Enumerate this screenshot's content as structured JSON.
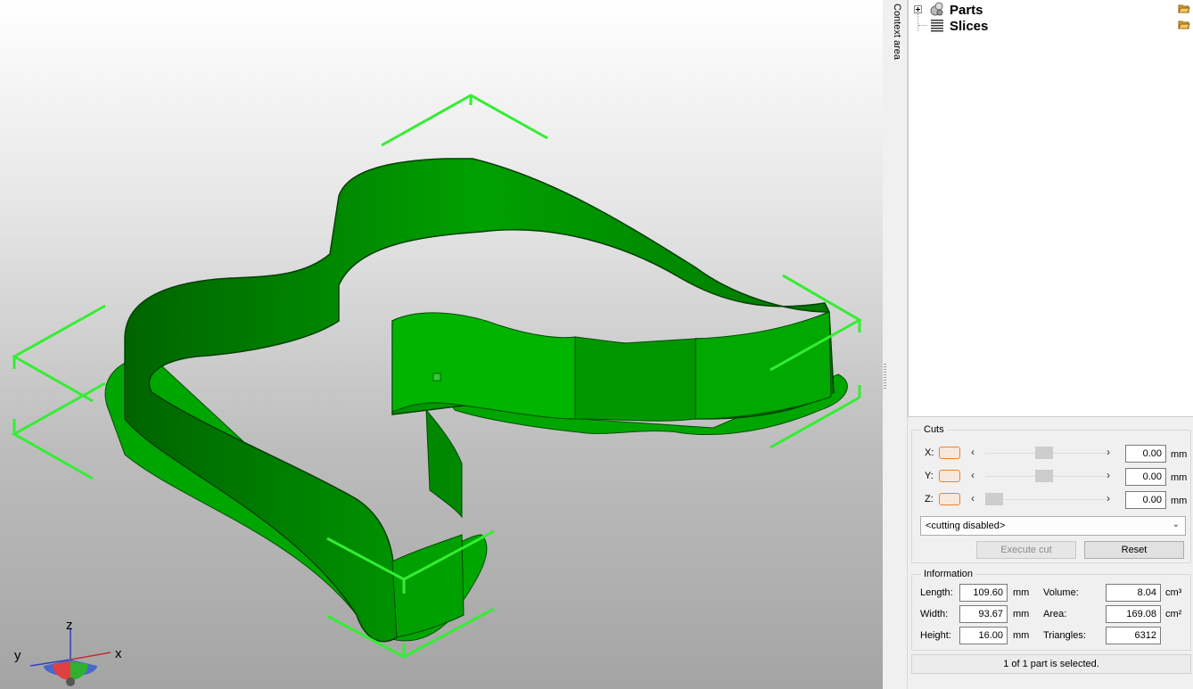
{
  "context_area_label": "Context area",
  "tree": {
    "items": [
      {
        "label": "Parts",
        "icon": "parts-icon"
      },
      {
        "label": "Slices",
        "icon": "slices-icon"
      }
    ]
  },
  "cuts": {
    "title": "Cuts",
    "axes": [
      {
        "axis": "X:",
        "value": "0.00",
        "unit": "mm",
        "slider_fraction": 0.5
      },
      {
        "axis": "Y:",
        "value": "0.00",
        "unit": "mm",
        "slider_fraction": 0.5
      },
      {
        "axis": "Z:",
        "value": "0.00",
        "unit": "mm",
        "slider_fraction": 0.0
      }
    ],
    "mode_select": "<cutting disabled>",
    "execute_label": "Execute cut",
    "reset_label": "Reset"
  },
  "information": {
    "title": "Information",
    "length_label": "Length:",
    "length_value": "109.60",
    "length_unit": "mm",
    "width_label": "Width:",
    "width_value": "93.67",
    "width_unit": "mm",
    "height_label": "Height:",
    "height_value": "16.00",
    "height_unit": "mm",
    "volume_label": "Volume:",
    "volume_value": "8.04",
    "volume_unit": "cm³",
    "area_label": "Area:",
    "area_value": "169.08",
    "area_unit": "cm²",
    "triangles_label": "Triangles:",
    "triangles_value": "6312"
  },
  "status": "1 of 1 part is selected.",
  "axes_gizmo": {
    "x": "x",
    "y": "y",
    "z": "z"
  },
  "colors": {
    "model": "#00b000",
    "selection_box": "#33ee33",
    "accent": "#f08030"
  }
}
